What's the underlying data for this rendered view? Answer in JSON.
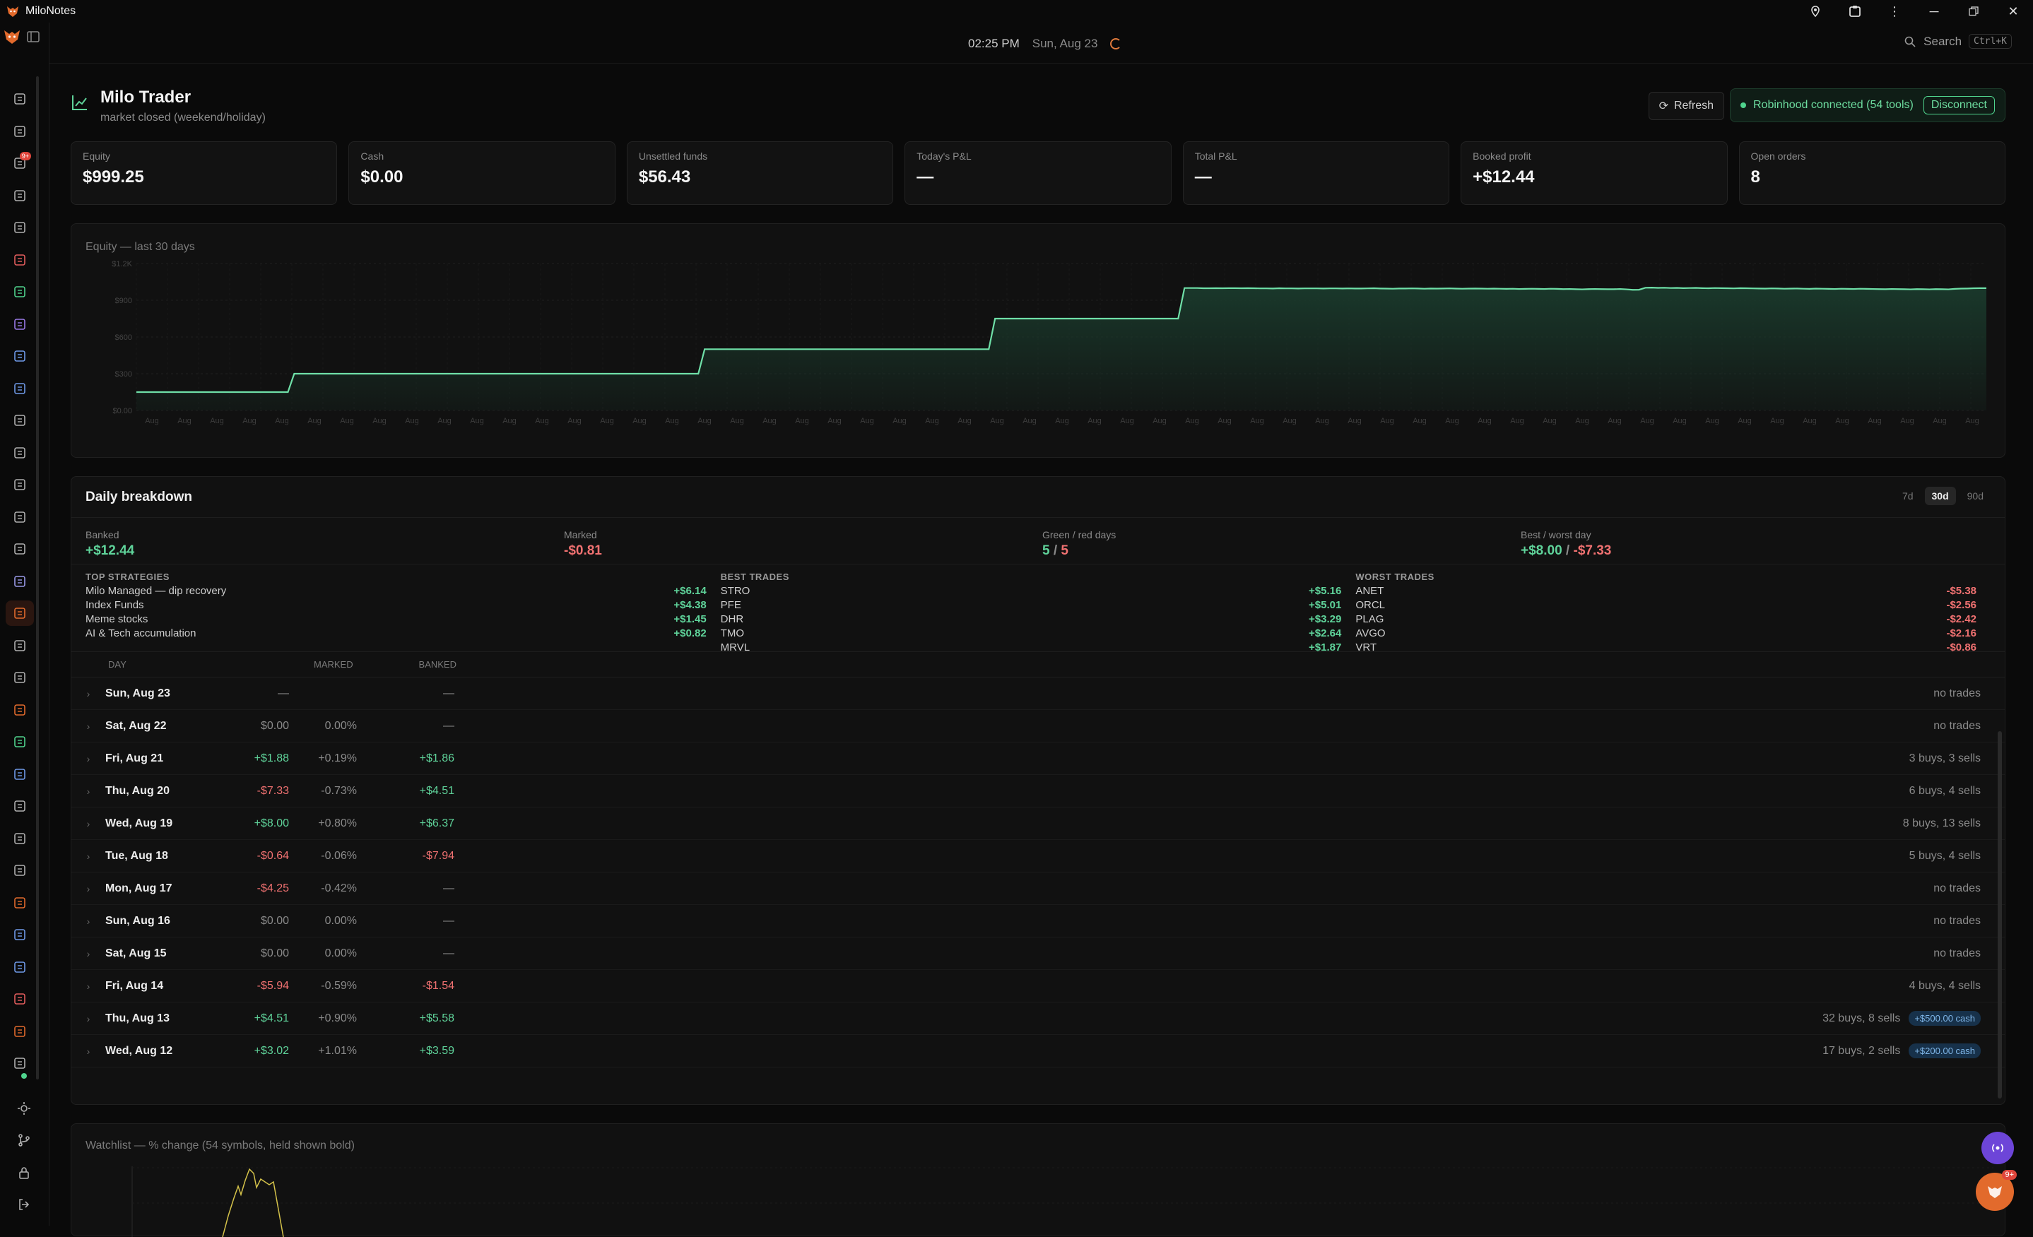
{
  "app": {
    "name": "MiloNotes"
  },
  "topbar": {
    "time": "02:25 PM",
    "date": "Sun, Aug 23",
    "search_label": "Search",
    "search_shortcut": "Ctrl+K"
  },
  "sidebar": {
    "badge": "9+"
  },
  "header": {
    "title": "Milo Trader",
    "subtitle": "market closed (weekend/holiday)",
    "refresh_label": "Refresh",
    "connection_label": "Robinhood connected (54 tools)",
    "disconnect_label": "Disconnect"
  },
  "stats": [
    {
      "label": "Equity",
      "value": "$999.25",
      "tone": "neutral"
    },
    {
      "label": "Cash",
      "value": "$0.00",
      "tone": "neutral"
    },
    {
      "label": "Unsettled funds",
      "value": "$56.43",
      "tone": "neutral"
    },
    {
      "label": "Today's P&L",
      "value": "—",
      "tone": "neutral"
    },
    {
      "label": "Total P&L",
      "value": "—",
      "tone": "neutral"
    },
    {
      "label": "Booked profit",
      "value": "+$12.44",
      "tone": "green"
    },
    {
      "label": "Open orders",
      "value": "8",
      "tone": "neutral"
    }
  ],
  "chart_data": {
    "type": "area",
    "title": "Equity — last 30 days",
    "ylim": [
      0,
      1200
    ],
    "yticks": [
      "$0.00",
      "$300",
      "$600",
      "$900",
      "$1.2K"
    ],
    "xtick_label": "Aug",
    "series": [
      {
        "values": [
          150,
          150,
          150,
          150,
          150,
          150,
          150,
          150,
          150,
          150,
          150,
          150,
          150,
          150,
          150,
          150,
          150,
          150,
          150,
          150,
          150,
          150,
          150,
          150,
          150,
          300,
          300,
          300,
          300,
          300,
          300,
          300,
          300,
          300,
          300,
          300,
          300,
          300,
          300,
          300,
          300,
          300,
          300,
          300,
          300,
          300,
          300,
          300,
          300,
          300,
          300,
          300,
          300,
          300,
          300,
          300,
          300,
          300,
          300,
          300,
          300,
          300,
          300,
          300,
          300,
          300,
          300,
          300,
          300,
          300,
          300,
          300,
          300,
          300,
          300,
          300,
          300,
          300,
          300,
          300,
          300,
          300,
          300,
          300,
          300,
          300,
          300,
          300,
          300,
          300,
          500,
          500,
          500,
          500,
          500,
          500,
          500,
          500,
          500,
          500,
          500,
          500,
          500,
          500,
          500,
          500,
          500,
          500,
          500,
          500,
          500,
          500,
          500,
          500,
          500,
          500,
          500,
          500,
          500,
          500,
          500,
          500,
          500,
          500,
          500,
          500,
          500,
          500,
          500,
          500,
          500,
          500,
          500,
          500,
          500,
          500,
          750,
          750,
          750,
          750,
          750,
          750,
          750,
          750,
          750,
          750,
          750,
          750,
          750,
          750,
          750,
          750,
          750,
          750,
          750,
          750,
          750,
          750,
          750,
          750,
          750,
          750,
          750,
          750,
          750,
          750,
          1000,
          1000,
          1000,
          998,
          998,
          999,
          998,
          999,
          999,
          998,
          999,
          998,
          997,
          997,
          996,
          998,
          997,
          997,
          996,
          997,
          997,
          997,
          996,
          997,
          997,
          996,
          997,
          996,
          996,
          997,
          998,
          996,
          995,
          994,
          996,
          996,
          997,
          996,
          994,
          996,
          995,
          996,
          997,
          995,
          994,
          995,
          996,
          995,
          994,
          995,
          994,
          993,
          994,
          992,
          993,
          994,
          993,
          992,
          994,
          993,
          991,
          992,
          990,
          989,
          991,
          992,
          991,
          990,
          990,
          992,
          989,
          985,
          986,
          1002,
          1003,
          1001,
          1002,
          1000,
          1001,
          999,
          1000,
          1001,
          999,
          998,
          1000,
          999,
          998,
          997,
          999,
          998,
          997,
          996,
          995,
          997,
          996,
          994,
          995,
          996,
          994,
          993,
          995,
          994,
          993,
          992,
          994,
          993,
          992,
          994,
          993,
          992,
          991,
          990,
          992,
          991,
          990,
          989,
          991,
          990,
          989,
          991,
          990,
          989,
          993,
          995,
          996,
          998,
          999,
          999
        ]
      }
    ],
    "colors": {
      "line": "#6fe0a8",
      "fill": "#1a3a2c"
    }
  },
  "breakdown": {
    "title": "Daily breakdown",
    "ranges": [
      "7d",
      "30d",
      "90d"
    ],
    "active_range": "30d",
    "summary": [
      {
        "label": "Banked",
        "value": "+$12.44",
        "tone": "green"
      },
      {
        "label": "Marked",
        "value": "-$0.81",
        "tone": "red"
      },
      {
        "label": "Green / red days",
        "value_green": "5",
        "value_sep": " / ",
        "value_red": "5"
      },
      {
        "label": "Best / worst day",
        "value_green": "+$8.00",
        "value_sep": " / ",
        "value_red": "-$7.33"
      }
    ],
    "lists": [
      {
        "heading": "TOP STRATEGIES",
        "rows": [
          {
            "name": "Milo Managed — dip recovery",
            "value": "+$6.14",
            "tone": "green"
          },
          {
            "name": "Index Funds",
            "value": "+$4.38",
            "tone": "green"
          },
          {
            "name": "Meme stocks",
            "value": "+$1.45",
            "tone": "green"
          },
          {
            "name": "AI & Tech accumulation",
            "value": "+$0.82",
            "tone": "green"
          }
        ]
      },
      {
        "heading": "BEST TRADES",
        "rows": [
          {
            "name": "STRO",
            "value": "+$5.16",
            "tone": "green"
          },
          {
            "name": "PFE",
            "value": "+$5.01",
            "tone": "green"
          },
          {
            "name": "DHR",
            "value": "+$3.29",
            "tone": "green"
          },
          {
            "name": "TMO",
            "value": "+$2.64",
            "tone": "green"
          },
          {
            "name": "MRVL",
            "value": "+$1.87",
            "tone": "green"
          }
        ]
      },
      {
        "heading": "WORST TRADES",
        "rows": [
          {
            "name": "ANET",
            "value": "-$5.38",
            "tone": "red"
          },
          {
            "name": "ORCL",
            "value": "-$2.56",
            "tone": "red"
          },
          {
            "name": "PLAG",
            "value": "-$2.42",
            "tone": "red"
          },
          {
            "name": "AVGO",
            "value": "-$2.16",
            "tone": "red"
          },
          {
            "name": "VRT",
            "value": "-$0.86",
            "tone": "red"
          }
        ]
      }
    ],
    "columns": {
      "day": "DAY",
      "marked": "MARKED",
      "banked": "BANKED"
    },
    "rows": [
      {
        "day": "Sun, Aug 23",
        "marked": "—",
        "pct": "",
        "banked": "—",
        "marked_tone": "muted",
        "banked_tone": "muted",
        "summary": "no trades",
        "cash": ""
      },
      {
        "day": "Sat, Aug 22",
        "marked": "$0.00",
        "pct": "0.00%",
        "banked": "—",
        "marked_tone": "muted",
        "banked_tone": "muted",
        "summary": "no trades",
        "cash": ""
      },
      {
        "day": "Fri, Aug 21",
        "marked": "+$1.88",
        "pct": "+0.19%",
        "banked": "+$1.86",
        "marked_tone": "green",
        "banked_tone": "green",
        "summary": "3 buys, 3 sells",
        "cash": ""
      },
      {
        "day": "Thu, Aug 20",
        "marked": "-$7.33",
        "pct": "-0.73%",
        "banked": "+$4.51",
        "marked_tone": "red",
        "banked_tone": "green",
        "summary": "6 buys, 4 sells",
        "cash": ""
      },
      {
        "day": "Wed, Aug 19",
        "marked": "+$8.00",
        "pct": "+0.80%",
        "banked": "+$6.37",
        "marked_tone": "green",
        "banked_tone": "green",
        "summary": "8 buys, 13 sells",
        "cash": ""
      },
      {
        "day": "Tue, Aug 18",
        "marked": "-$0.64",
        "pct": "-0.06%",
        "banked": "-$7.94",
        "marked_tone": "red",
        "banked_tone": "red",
        "summary": "5 buys, 4 sells",
        "cash": ""
      },
      {
        "day": "Mon, Aug 17",
        "marked": "-$4.25",
        "pct": "-0.42%",
        "banked": "—",
        "marked_tone": "red",
        "banked_tone": "muted",
        "summary": "no trades",
        "cash": ""
      },
      {
        "day": "Sun, Aug 16",
        "marked": "$0.00",
        "pct": "0.00%",
        "banked": "—",
        "marked_tone": "muted",
        "banked_tone": "muted",
        "summary": "no trades",
        "cash": ""
      },
      {
        "day": "Sat, Aug 15",
        "marked": "$0.00",
        "pct": "0.00%",
        "banked": "—",
        "marked_tone": "muted",
        "banked_tone": "muted",
        "summary": "no trades",
        "cash": ""
      },
      {
        "day": "Fri, Aug 14",
        "marked": "-$5.94",
        "pct": "-0.59%",
        "banked": "-$1.54",
        "marked_tone": "red",
        "banked_tone": "red",
        "summary": "4 buys, 4 sells",
        "cash": ""
      },
      {
        "day": "Thu, Aug 13",
        "marked": "+$4.51",
        "pct": "+0.90%",
        "banked": "+$5.58",
        "marked_tone": "green",
        "banked_tone": "green",
        "summary": "32 buys, 8 sells",
        "cash": "+$500.00 cash"
      },
      {
        "day": "Wed, Aug 12",
        "marked": "+$3.02",
        "pct": "+1.01%",
        "banked": "+$3.59",
        "marked_tone": "green",
        "banked_tone": "green",
        "summary": "17 buys, 2 sells",
        "cash": "+$200.00 cash"
      }
    ]
  },
  "watchlist": {
    "title": "Watchlist — % change (54 symbols, held shown bold)"
  },
  "fab": {
    "badge": "9+"
  }
}
